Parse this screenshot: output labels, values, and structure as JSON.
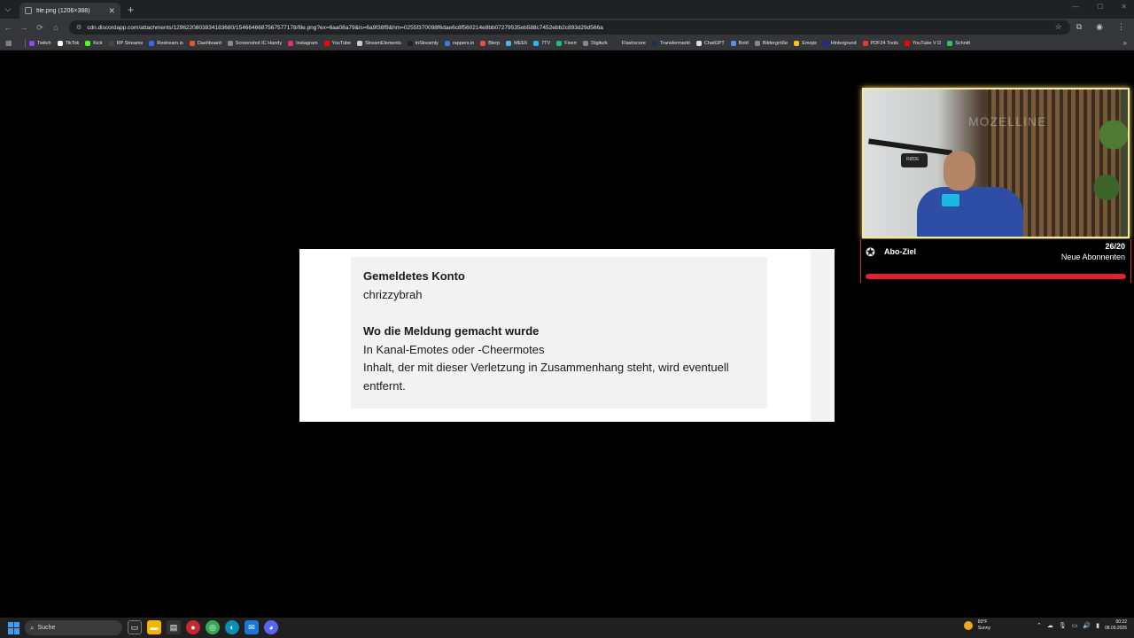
{
  "browser": {
    "tab_title": "file.png (1206×388)",
    "url": "cdn.discordapp.com/attachments/1296220803834183680/1546646687567577178/file.png?ex=6aa08a79&is=6a9f38f9&hm=0255f370098f6dae6c8f560214e8bb07279535eb588c7452ebb2c893d29d566a",
    "bookmarks": [
      {
        "label": "Twitch",
        "color": "#9146ff"
      },
      {
        "label": "TikTok",
        "color": "#ffffff"
      },
      {
        "label": "Kick",
        "color": "#53fc18"
      },
      {
        "label": "RP Streams",
        "color": "#444444"
      },
      {
        "label": "Restream.io",
        "color": "#2f6cf6"
      },
      {
        "label": "Dashboard",
        "color": "#e8542b"
      },
      {
        "label": "Screenshot IC Handy",
        "color": "#888888"
      },
      {
        "label": "Instagram",
        "color": "#e1306c"
      },
      {
        "label": "YouTube",
        "color": "#ff0000"
      },
      {
        "label": "StreamElements",
        "color": "#cccccc"
      },
      {
        "label": "inStreamly",
        "color": "#222222"
      },
      {
        "label": "rappers.in",
        "color": "#3a7bd5"
      },
      {
        "label": "Blerp",
        "color": "#f04a4a"
      },
      {
        "label": "MEE6",
        "color": "#4ab6e8"
      },
      {
        "label": "7TV",
        "color": "#29b6f6"
      },
      {
        "label": "Fiverr",
        "color": "#1dbf73"
      },
      {
        "label": "Digiturk",
        "color": "#888888"
      },
      {
        "label": "Flashscore",
        "color": "#333333"
      },
      {
        "label": "Transfermarkt",
        "color": "#1a3151"
      },
      {
        "label": "ChatGPT",
        "color": "#dddddd"
      },
      {
        "label": "Bold",
        "color": "#5b8def"
      },
      {
        "label": "Bildergröße",
        "color": "#888888"
      },
      {
        "label": "Emojis",
        "color": "#f5c518"
      },
      {
        "label": "Hintergrund",
        "color": "#2222aa"
      },
      {
        "label": "PDF24 Tools",
        "color": "#e53935"
      },
      {
        "label": "YouTube V D",
        "color": "#ff0000"
      },
      {
        "label": "Schnitt",
        "color": "#3cbf5b"
      }
    ]
  },
  "report": {
    "account_label": "Gemeldetes Konto",
    "account_value": "chrizzybrah",
    "location_label": "Wo die Meldung gemacht wurde",
    "location_value_1": "In Kanal-Emotes oder -Cheermotes",
    "location_value_2": "Inhalt, der mit dieser Verletzung in Zusammenhang steht, wird eventuell entfernt."
  },
  "overlay": {
    "mic_label": "RØDE",
    "logo_text": "MOZELLINE",
    "goal_title": "Abo-Ziel",
    "goal_count": "26/20",
    "goal_subtitle": "Neue Abonnenten",
    "goal_progress": 1.0,
    "goal_color": "#e0202a"
  },
  "taskbar": {
    "search_label": "Suche",
    "weather_temp": "83°F",
    "weather_condition": "Sunny",
    "time": "00:22",
    "date": "08.09.2026"
  }
}
